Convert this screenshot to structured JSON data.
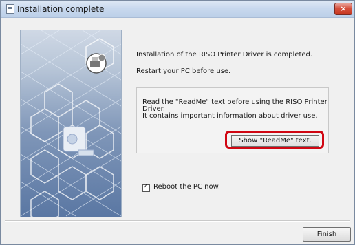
{
  "window": {
    "title": "Installation complete",
    "close_label": "×"
  },
  "main": {
    "line1": "Installation of the RISO Printer Driver is completed.",
    "line2": "Restart your PC before use."
  },
  "readme": {
    "line1": "Read the \"ReadMe\" text before using the RISO Printer",
    "line2": "Driver.",
    "line3": "It contains important information about driver use.",
    "button_label": "Show \"ReadMe\" text."
  },
  "reboot": {
    "checked": true,
    "label": "Reboot the PC now."
  },
  "footer": {
    "finish_label": "Finish"
  },
  "colors": {
    "highlight_border": "#d00612",
    "close_button": "#c7371f"
  }
}
